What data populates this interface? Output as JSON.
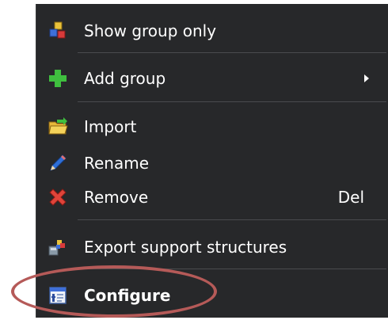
{
  "menu": {
    "items": [
      {
        "label": "Show group only",
        "icon": "group-cubes-icon"
      },
      {
        "label": "Add group",
        "icon": "plus-icon",
        "submenu": true
      },
      {
        "label": "Import",
        "icon": "folder-import-icon"
      },
      {
        "label": "Rename",
        "icon": "pencil-icon"
      },
      {
        "label": "Remove",
        "icon": "red-x-icon",
        "shortcut": "Del"
      },
      {
        "label": "Export support structures",
        "icon": "export-support-icon"
      },
      {
        "label": "Configure",
        "icon": "configure-icon"
      }
    ]
  },
  "colors": {
    "menu_background": "#27282a",
    "text": "#ffffff",
    "separator": "#4a4b4e",
    "highlight_ring": "#b55a58"
  }
}
